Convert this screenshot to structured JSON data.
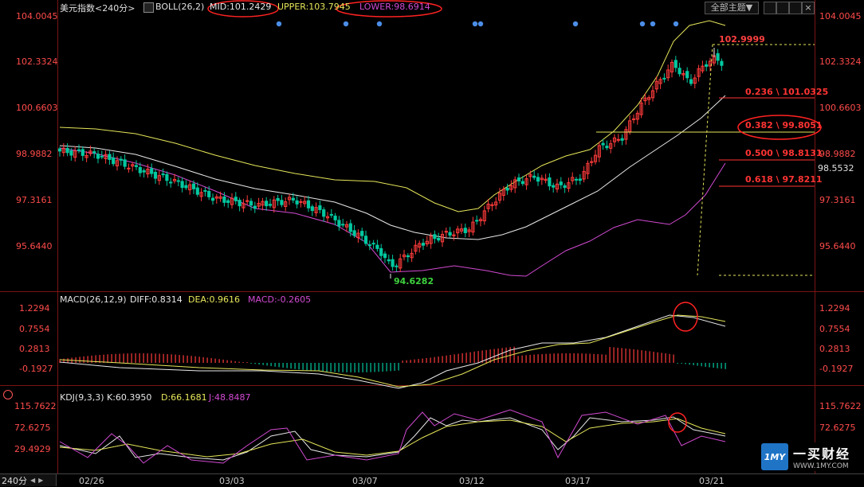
{
  "header": {
    "title": "美元指数<240分>",
    "boll_label": "BOLL(26,2)",
    "mid": "MID:101.2429",
    "upper": "UPPER:103.7945",
    "lower": "LOWER:98.6914",
    "theme_menu": "全部主题▼"
  },
  "price_axis": {
    "left_ticks": [
      "104.0045",
      "102.3324",
      "100.6603",
      "98.9882",
      "97.3161",
      "95.6440"
    ],
    "right_ticks": [
      "104.0045",
      "102.3324",
      "100.6603",
      "98.9882",
      "97.3161",
      "95.6440"
    ],
    "current_price": "98.5532"
  },
  "annotations": {
    "high": "102.9999",
    "low": "94.6282",
    "fib": [
      {
        "ratio": "0.236",
        "value": "101.0325"
      },
      {
        "ratio": "0.382",
        "value": "99.8051"
      },
      {
        "ratio": "0.500",
        "value": "98.8131"
      },
      {
        "ratio": "0.618",
        "value": "97.8211"
      }
    ]
  },
  "macd": {
    "name": "MACD(26,12,9)",
    "diff": "DIFF:0.8314",
    "dea": "DEA:0.9616",
    "macd": "MACD:-0.2605",
    "ticks": [
      "1.2294",
      "0.7554",
      "0.2813",
      "-0.1927"
    ]
  },
  "kdj": {
    "name": "KDJ(9,3,3)",
    "k": "K:60.3950",
    "d": "D:66.1681",
    "j": "J:48.8487",
    "ticks": [
      "115.7622",
      "72.6275",
      "29.4929"
    ]
  },
  "x_axis": [
    "02/26",
    "03/03",
    "03/07",
    "03/12",
    "03/17",
    "03/21"
  ],
  "period_button": "240分",
  "brand": {
    "name": "一买财经",
    "url": "WWW.1MY.COM",
    "logo_text": "1MY"
  },
  "colors": {
    "up": "#ff3b3b",
    "down": "#00c8a0",
    "mid": "#e8e8e8",
    "upper": "#e6e65a",
    "lower": "#d24ad2",
    "dea": "#e6e65a",
    "fib": "#ff3333"
  }
}
